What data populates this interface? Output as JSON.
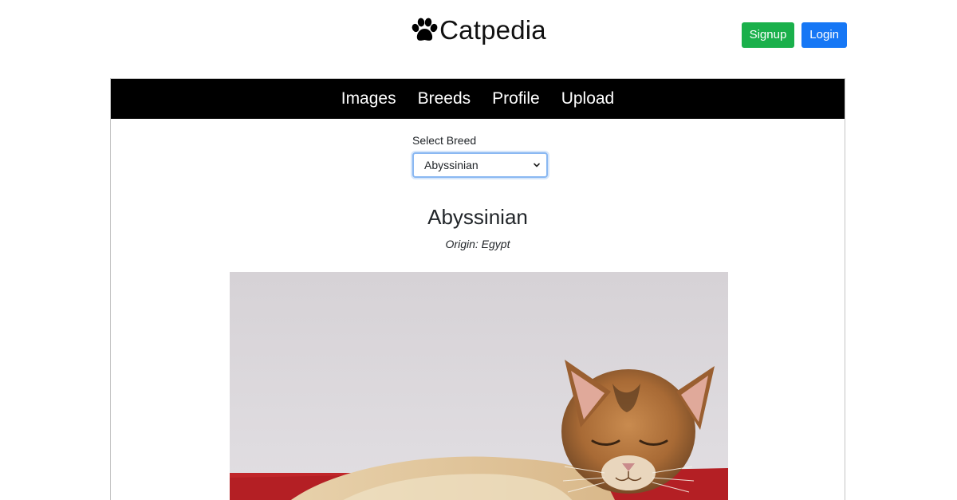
{
  "brand": {
    "title": "Catpedia",
    "logo_icon": "paw-icon"
  },
  "auth": {
    "signup_label": "Signup",
    "login_label": "Login",
    "signup_color": "#1ab04b",
    "login_color": "#1677f5"
  },
  "nav": {
    "items": [
      {
        "label": "Images"
      },
      {
        "label": "Breeds"
      },
      {
        "label": "Profile"
      },
      {
        "label": "Upload"
      }
    ]
  },
  "breed_select": {
    "label": "Select Breed",
    "selected": "Abyssinian"
  },
  "breed": {
    "name": "Abyssinian",
    "origin": "Origin: Egypt",
    "photo_description": "cat-photo"
  }
}
